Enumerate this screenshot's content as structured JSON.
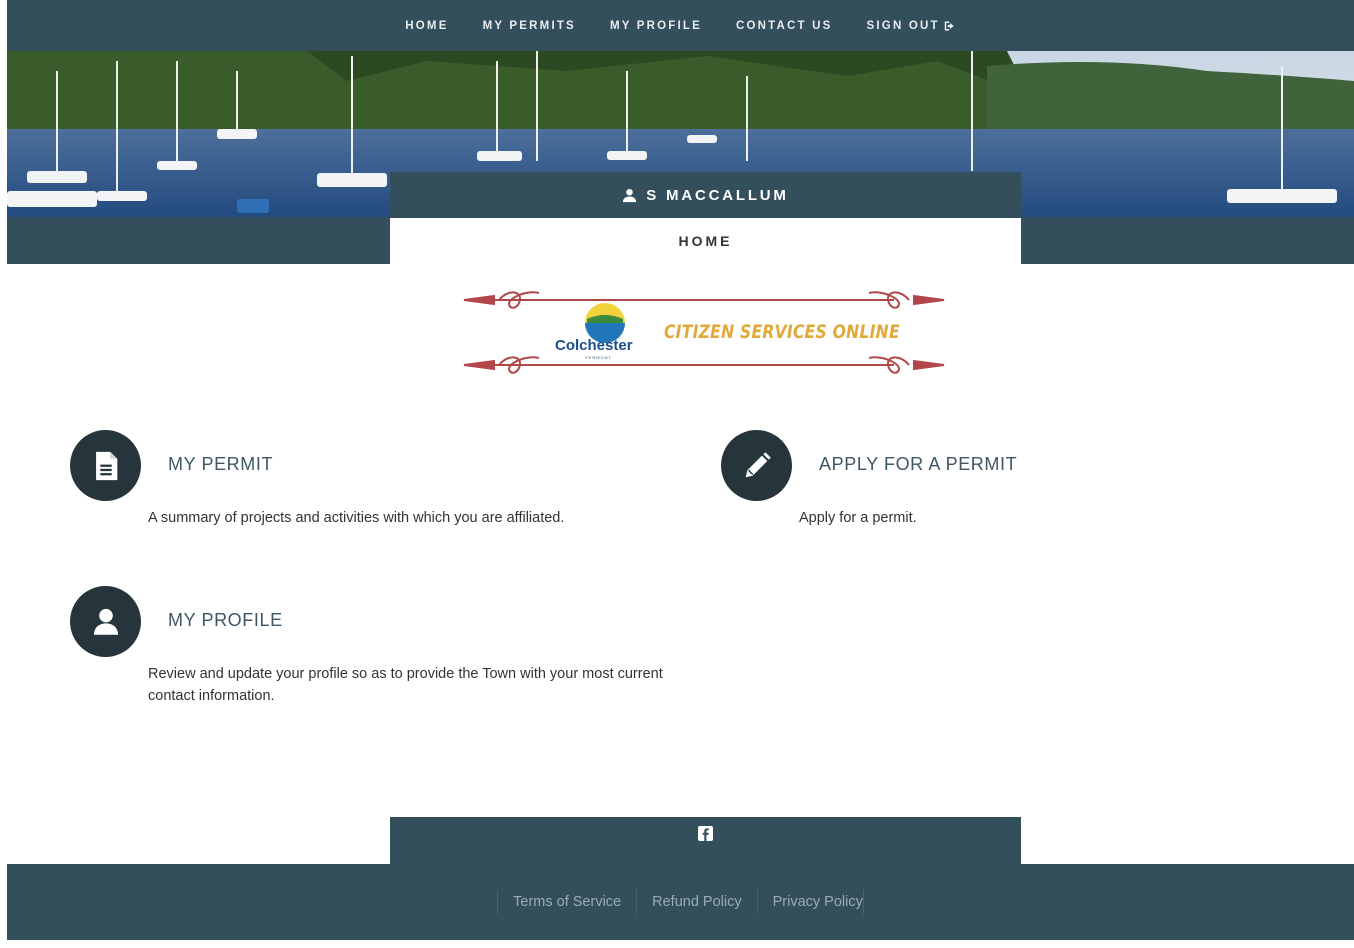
{
  "nav": {
    "items": [
      {
        "label": "HOME"
      },
      {
        "label": "MY PERMITS"
      },
      {
        "label": "MY PROFILE"
      },
      {
        "label": "CONTACT US"
      },
      {
        "label": "SIGN OUT"
      }
    ],
    "sign_out_icon": "sign-out-icon"
  },
  "user": {
    "name": "S MACCALLUM",
    "icon": "user-icon"
  },
  "page_tab": {
    "label": "HOME"
  },
  "logo": {
    "brand": "Colchester",
    "state": "VERMONT",
    "tagline": "CITIZEN SERVICES ONLINE"
  },
  "cards": {
    "permit": {
      "title": "MY PERMIT",
      "desc": "A summary of projects and activities with which you are affiliated.",
      "icon": "document-icon"
    },
    "apply": {
      "title": "APPLY FOR A PERMIT",
      "desc": "Apply for a permit.",
      "icon": "pencil-icon"
    },
    "profile": {
      "title": "MY PROFILE",
      "desc": "Review and update your profile so as to provide the Town with your most current contact information.",
      "icon": "user-icon"
    }
  },
  "footer": {
    "social_icon": "facebook-icon",
    "links": [
      {
        "label": "Terms of Service"
      },
      {
        "label": "Refund Policy"
      },
      {
        "label": "Privacy Policy"
      }
    ]
  },
  "colors": {
    "header": "#334f5c",
    "icon_circle": "#26353c",
    "tagline": "#e1a93a",
    "ornament": "#b1474a"
  }
}
